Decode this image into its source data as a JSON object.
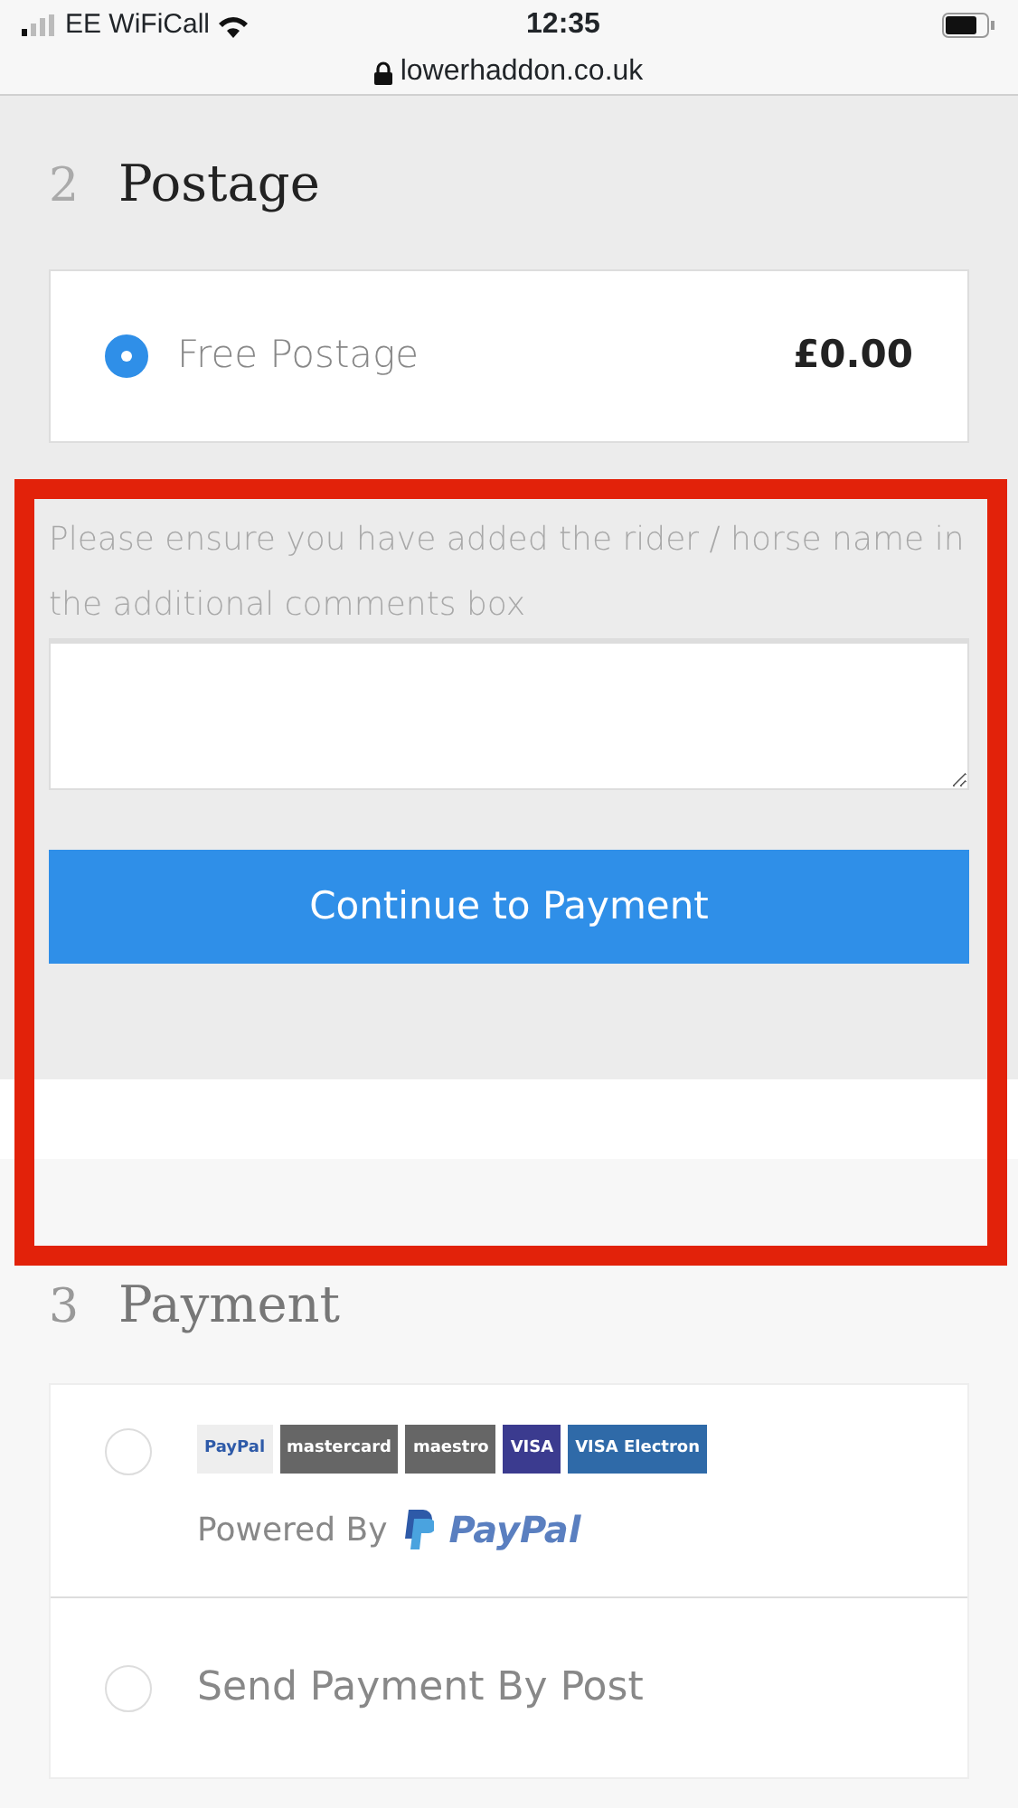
{
  "status_bar": {
    "carrier": "EE WiFiCall",
    "time": "12:35",
    "url": "lowerhaddon.co.uk"
  },
  "postage": {
    "number": "2",
    "title": "Postage",
    "options": [
      {
        "label": "Free Postage",
        "price": "£0.00",
        "selected": true
      }
    ]
  },
  "note": "Please ensure you have added the rider / horse name in the additional comments box",
  "continue_button": "Continue to Payment",
  "payment": {
    "number": "3",
    "title": "Payment",
    "methods": [
      {
        "kind": "cards",
        "selected": false,
        "logos": [
          {
            "kind": "paypal",
            "text": "PayPal"
          },
          {
            "kind": "mastercard",
            "text": "mastercard"
          },
          {
            "kind": "maestro",
            "text": "maestro"
          },
          {
            "kind": "visa",
            "text": "VISA"
          },
          {
            "kind": "electron",
            "text": "VISA Electron"
          }
        ],
        "powered_by": "Powered By",
        "brand": "PayPal"
      },
      {
        "kind": "text",
        "selected": false,
        "label": "Send Payment By Post"
      }
    ]
  }
}
